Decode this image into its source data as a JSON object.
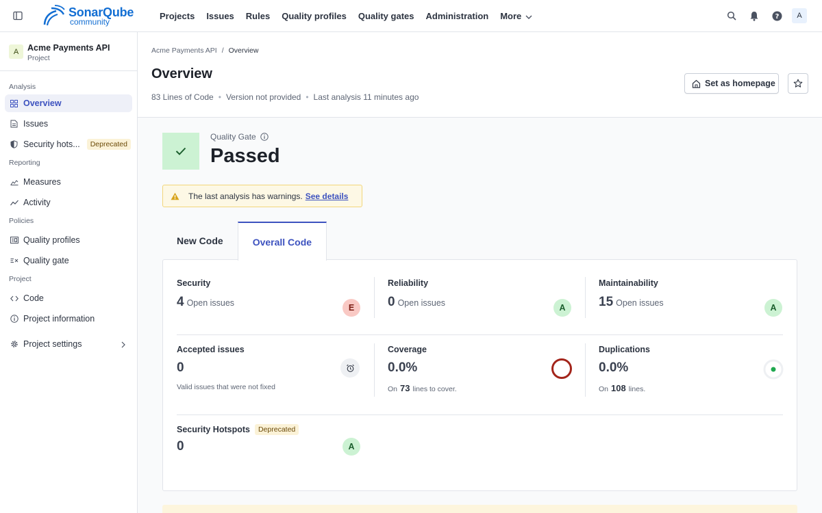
{
  "logo": {
    "brand_a": "Sonar",
    "brand_b": "Qube",
    "edition": "community"
  },
  "nav": {
    "items": [
      "Projects",
      "Issues",
      "Rules",
      "Quality profiles",
      "Quality gates",
      "Administration",
      "More"
    ]
  },
  "user": {
    "initial": "A"
  },
  "project": {
    "initial": "A",
    "name": "Acme Payments API",
    "type": "Project"
  },
  "sidebar": {
    "analysis_label": "Analysis",
    "overview": "Overview",
    "issues": "Issues",
    "security_hotspots": "Security hots...",
    "deprecated": "Deprecated",
    "reporting_label": "Reporting",
    "measures": "Measures",
    "activity": "Activity",
    "policies_label": "Policies",
    "quality_profiles": "Quality profiles",
    "quality_gate": "Quality gate",
    "project_label": "Project",
    "code": "Code",
    "project_information": "Project information",
    "project_settings": "Project settings"
  },
  "header": {
    "breadcrumb_project": "Acme Payments API",
    "breadcrumb_sep": "/",
    "breadcrumb_current": "Overview",
    "title": "Overview",
    "loc": "83 Lines of Code",
    "version": "Version not provided",
    "last_analysis": "Last analysis 11 minutes ago",
    "dot": "•",
    "set_homepage": "Set as homepage"
  },
  "quality_gate": {
    "label": "Quality Gate",
    "status": "Passed",
    "status_color": "#ccf2d3"
  },
  "warning": {
    "text": "The last analysis has warnings.",
    "link": "See details"
  },
  "tabs": {
    "new_code": "New Code",
    "overall_code": "Overall Code"
  },
  "metrics": {
    "security": {
      "title": "Security",
      "value": "4",
      "unit": "Open issues",
      "rating": "E"
    },
    "reliability": {
      "title": "Reliability",
      "value": "0",
      "unit": "Open issues",
      "rating": "A"
    },
    "maintainability": {
      "title": "Maintainability",
      "value": "15",
      "unit": "Open issues",
      "rating": "A"
    },
    "accepted": {
      "title": "Accepted issues",
      "value": "0",
      "sub": "Valid issues that were not fixed"
    },
    "coverage": {
      "title": "Coverage",
      "value": "0.0%",
      "sub_pre": "On",
      "sub_num": "73",
      "sub_post": "lines to cover."
    },
    "duplications": {
      "title": "Duplications",
      "value": "0.0%",
      "sub_pre": "On",
      "sub_num": "108",
      "sub_post": "lines."
    },
    "hotspots": {
      "title": "Security Hotspots",
      "badge": "Deprecated",
      "value": "0",
      "rating": "A"
    }
  },
  "colors": {
    "accent": "#3d52bf",
    "passed": "#ccf2d3",
    "rating_e": "#f9c9c4",
    "rating_a": "#ccf2d3",
    "coverage_ring": "#a3241a",
    "dup_dot": "#1fa84f"
  }
}
